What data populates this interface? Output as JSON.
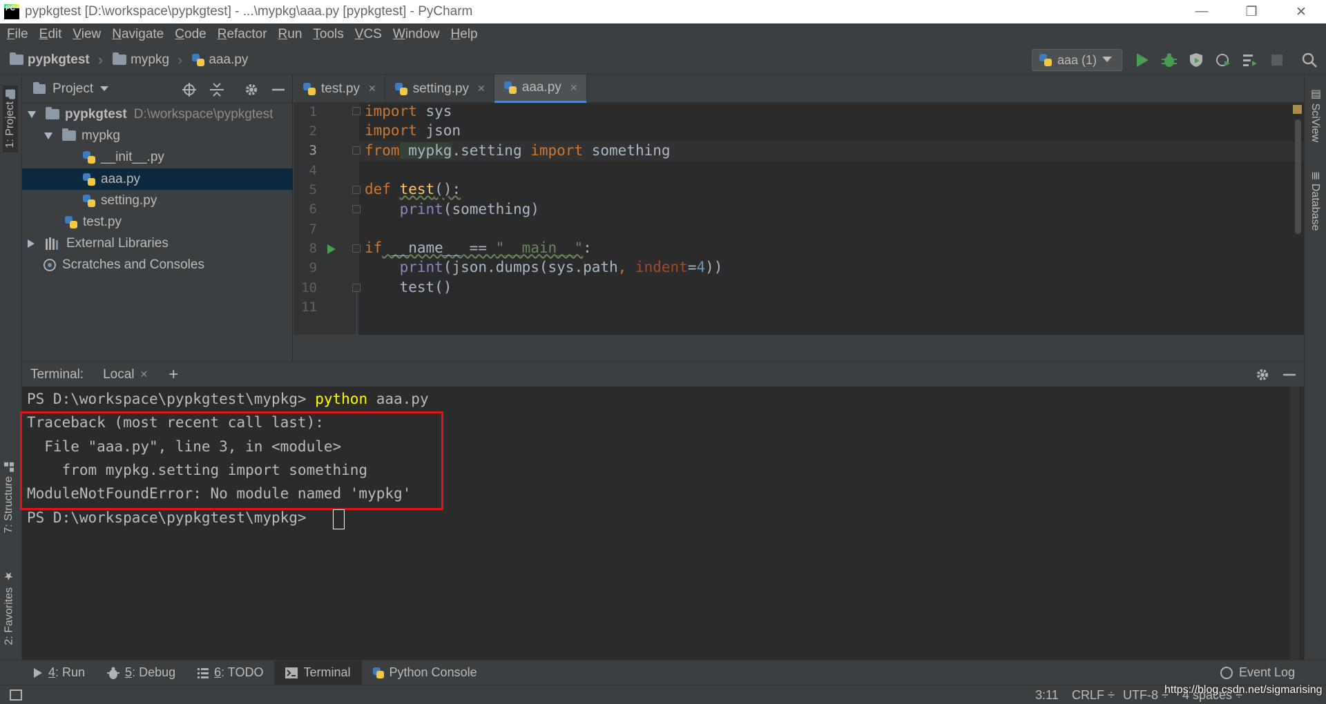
{
  "window": {
    "title": "pypkgtest [D:\\workspace\\pypkgtest] - ...\\mypkg\\aaa.py [pypkgtest] - PyCharm",
    "minimize": "—",
    "restore": "❐",
    "close": "✕"
  },
  "menu": [
    "File",
    "Edit",
    "View",
    "Navigate",
    "Code",
    "Refactor",
    "Run",
    "Tools",
    "VCS",
    "Window",
    "Help"
  ],
  "breadcrumb": [
    "pypkgtest",
    "mypkg",
    "aaa.py"
  ],
  "run_config": "aaa (1)",
  "left_tabs": {
    "project": "1: Project",
    "structure": "7: Structure",
    "favorites": "2: Favorites"
  },
  "right_tabs": {
    "sciview": "SciView",
    "database": "Database"
  },
  "project_panel": {
    "title": "Project",
    "root": {
      "name": "pypkgtest",
      "path": "D:\\workspace\\pypkgtest"
    },
    "items": [
      "mypkg",
      "__init__.py",
      "aaa.py",
      "setting.py",
      "test.py",
      "External Libraries",
      "Scratches and Consoles"
    ]
  },
  "editor_tabs": [
    "test.py",
    "setting.py",
    "aaa.py"
  ],
  "line_numbers": [
    "1",
    "2",
    "3",
    "4",
    "5",
    "6",
    "7",
    "8",
    "9",
    "10",
    "11"
  ],
  "code": {
    "l1": [
      "import",
      " sys"
    ],
    "l2": [
      "import",
      " json"
    ],
    "l3": [
      "from",
      " mypkg",
      ".setting ",
      "import",
      " something"
    ],
    "l5": [
      "def",
      " ",
      "test",
      "():"
    ],
    "l6": [
      "    ",
      "print",
      "(something)"
    ],
    "l8": [
      "if",
      " __name__ == ",
      "\"__main__\"",
      ":"
    ],
    "l9": [
      "    ",
      "print",
      "(json.dumps(sys.path",
      ", ",
      "indent",
      "=",
      "4",
      "))"
    ],
    "l10": [
      "    test()"
    ]
  },
  "terminal": {
    "label": "Terminal:",
    "tab": "Local",
    "add": "+",
    "prompt": "PS D:\\workspace\\pypkgtest\\mypkg>",
    "command": "python",
    "command_arg": " aaa.py",
    "lines": [
      "Traceback (most recent call last):",
      "  File \"aaa.py\", line 3, in <module>",
      "    from mypkg.setting import something",
      "ModuleNotFoundError: No module named 'mypkg'"
    ]
  },
  "bottom_tabs": [
    {
      "key": "4",
      "label": ": Run"
    },
    {
      "key": "5",
      "label": ": Debug"
    },
    {
      "key": "6",
      "label": ": TODO"
    },
    {
      "key": "",
      "label": "Terminal"
    },
    {
      "key": "",
      "label": "Python Console"
    }
  ],
  "event_log": "Event Log",
  "status": {
    "position": "3:11",
    "line_sep": "CRLF ÷",
    "encoding": "UTF-8 ÷",
    "indent": "4 spaces ÷",
    "watermark": "https://blog.csdn.net/sigmarising"
  },
  "colors": {
    "accent": "#4a88c7",
    "error_box": "#e0141b",
    "run_green": "#499c54",
    "keyword": "#cc7832"
  }
}
